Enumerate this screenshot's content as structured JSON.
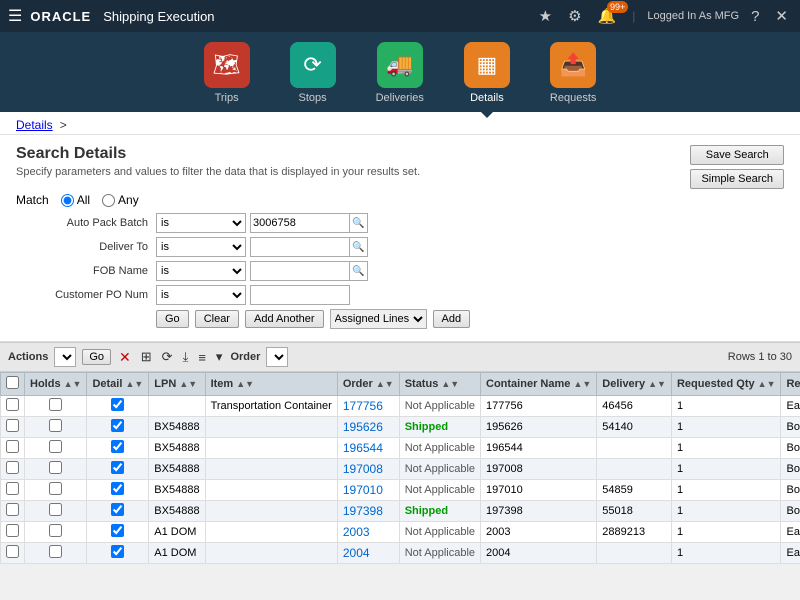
{
  "app": {
    "title": "ORACLE",
    "subtitle": "Shipping Execution",
    "user": "Logged In As MFG",
    "notification_count": "99+"
  },
  "nav": {
    "items": [
      {
        "id": "trips",
        "label": "Trips",
        "icon": "🗺",
        "color": "#c0392b"
      },
      {
        "id": "stops",
        "label": "Stops",
        "icon": "⟳",
        "color": "#16a085"
      },
      {
        "id": "deliveries",
        "label": "Deliveries",
        "icon": "🚚",
        "color": "#27ae60"
      },
      {
        "id": "details",
        "label": "Details",
        "icon": "▦",
        "color": "#e67e22",
        "active": true
      },
      {
        "id": "requests",
        "label": "Requests",
        "icon": "📤",
        "color": "#e67e22"
      }
    ]
  },
  "breadcrumb": {
    "items": [
      "Details",
      ">"
    ],
    "link": "Details"
  },
  "search": {
    "title": "Search Details",
    "description": "Specify parameters and values to filter the data that is displayed in your results set.",
    "save_button": "Save Search",
    "simple_button": "Simple Search",
    "match_label": "Match",
    "match_all": "All",
    "match_any": "Any",
    "fields": [
      {
        "label": "Auto Pack Batch",
        "operator": "is",
        "value": "3006758",
        "has_search": true
      },
      {
        "label": "Deliver To",
        "operator": "is",
        "value": "",
        "has_search": true
      },
      {
        "label": "FOB Name",
        "operator": "is",
        "value": "",
        "has_search": true
      },
      {
        "label": "Customer PO Num",
        "operator": "is",
        "value": "",
        "has_search": false
      }
    ],
    "go_label": "Go",
    "clear_label": "Clear",
    "add_another_label": "Add Another",
    "assigned_lines_label": "Assigned Lines",
    "add_label": "Add"
  },
  "toolbar": {
    "actions_label": "Actions",
    "go_label": "Go",
    "order_label": "Order",
    "rows_info": "Rows 1 to 30"
  },
  "table": {
    "columns": [
      "",
      "Holds",
      "Detail",
      "LPN",
      "Item",
      "Order",
      "Status",
      "Container Name",
      "Delivery",
      "Requested Qty",
      "Requested UOM"
    ],
    "rows": [
      {
        "id": "177756",
        "holds": "",
        "detail": true,
        "lpn": "",
        "item": "Transportation Container",
        "order": "177756",
        "status": "Not Applicable",
        "container_name": "177756",
        "delivery": "46456",
        "req_qty": "1",
        "req_uom": "Ea"
      },
      {
        "id": "195626",
        "holds": "",
        "detail": true,
        "lpn": "BX54888",
        "item": "",
        "order": "195626",
        "status": "Shipped",
        "container_name": "195626",
        "delivery": "54140",
        "req_qty": "1",
        "req_uom": "Box"
      },
      {
        "id": "196544",
        "holds": "",
        "detail": true,
        "lpn": "BX54888",
        "item": "",
        "order": "196544",
        "status": "Not Applicable",
        "container_name": "196544",
        "delivery": "",
        "req_qty": "1",
        "req_uom": "Box"
      },
      {
        "id": "197008",
        "holds": "",
        "detail": true,
        "lpn": "BX54888",
        "item": "",
        "order": "197008",
        "status": "Not Applicable",
        "container_name": "197008",
        "delivery": "",
        "req_qty": "1",
        "req_uom": "Box"
      },
      {
        "id": "197010",
        "holds": "",
        "detail": true,
        "lpn": "BX54888",
        "item": "",
        "order": "197010",
        "status": "Not Applicable",
        "container_name": "197010",
        "delivery": "54859",
        "req_qty": "1",
        "req_uom": "Box"
      },
      {
        "id": "197398",
        "holds": "",
        "detail": true,
        "lpn": "BX54888",
        "item": "",
        "order": "197398",
        "status": "Shipped",
        "container_name": "197398",
        "delivery": "55018",
        "req_qty": "1",
        "req_uom": "Box"
      },
      {
        "id": "2003",
        "holds": "",
        "detail": true,
        "lpn": "A1 DOM",
        "item": "",
        "order": "2003",
        "status": "Not Applicable",
        "container_name": "2003",
        "delivery": "2889213",
        "req_qty": "1",
        "req_uom": "Ea"
      },
      {
        "id": "2004",
        "holds": "",
        "detail": true,
        "lpn": "A1 DOM",
        "item": "",
        "order": "2004",
        "status": "Not Applicable",
        "container_name": "2004",
        "delivery": "",
        "req_qty": "1",
        "req_uom": "Ea"
      }
    ]
  }
}
